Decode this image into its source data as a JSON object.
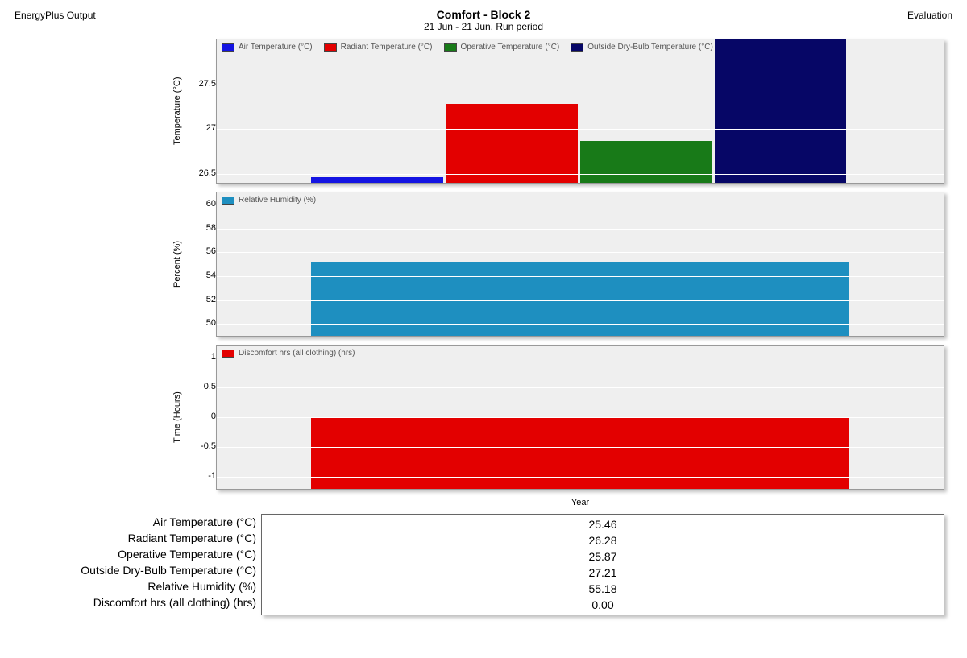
{
  "header": {
    "left": "EnergyPlus Output",
    "title": "Comfort - Block 2",
    "subtitle": "21 Jun - 21 Jun, Run period",
    "right": "Evaluation"
  },
  "xlabel": "Year",
  "chart_data": [
    {
      "type": "bar",
      "ylabel": "Temperature (°C)",
      "ylim": [
        26.4,
        28.0
      ],
      "yticks": [
        27.5,
        27.0,
        26.5
      ],
      "series": [
        {
          "name": "Air Temperature (°C)",
          "color": "#1414e2",
          "value": 26.46
        },
        {
          "name": "Radiant Temperature (°C)",
          "color": "#e30000",
          "value": 27.28
        },
        {
          "name": "Operative Temperature (°C)",
          "color": "#187a18",
          "value": 26.87
        },
        {
          "name": "Outside Dry-Bulb Temperature (°C)",
          "color": "#060666",
          "value": 28.0
        }
      ]
    },
    {
      "type": "bar",
      "ylabel": "Percent (%)",
      "ylim": [
        49,
        61
      ],
      "yticks": [
        60,
        58,
        56,
        54,
        52,
        50
      ],
      "series": [
        {
          "name": "Relative Humidity (%)",
          "color": "#1e8fc0",
          "value": 55.18
        }
      ]
    },
    {
      "type": "bar",
      "ylabel": "Time (Hours)",
      "ylim": [
        -1.2,
        1.2
      ],
      "yticks": [
        1.0,
        0.5,
        0,
        -0.5,
        -1.0
      ],
      "series": [
        {
          "name": "Discomfort hrs (all clothing) (hrs)",
          "color": "#e30000",
          "value": 0.0
        }
      ]
    }
  ],
  "table": {
    "rows": [
      {
        "label": "Air Temperature (°C)",
        "value": "25.46"
      },
      {
        "label": "Radiant Temperature (°C)",
        "value": "26.28"
      },
      {
        "label": "Operative Temperature (°C)",
        "value": "25.87"
      },
      {
        "label": "Outside Dry-Bulb Temperature (°C)",
        "value": "27.21"
      },
      {
        "label": "Relative Humidity (%)",
        "value": "55.18"
      },
      {
        "label": "Discomfort hrs (all clothing) (hrs)",
        "value": "0.00"
      }
    ]
  }
}
